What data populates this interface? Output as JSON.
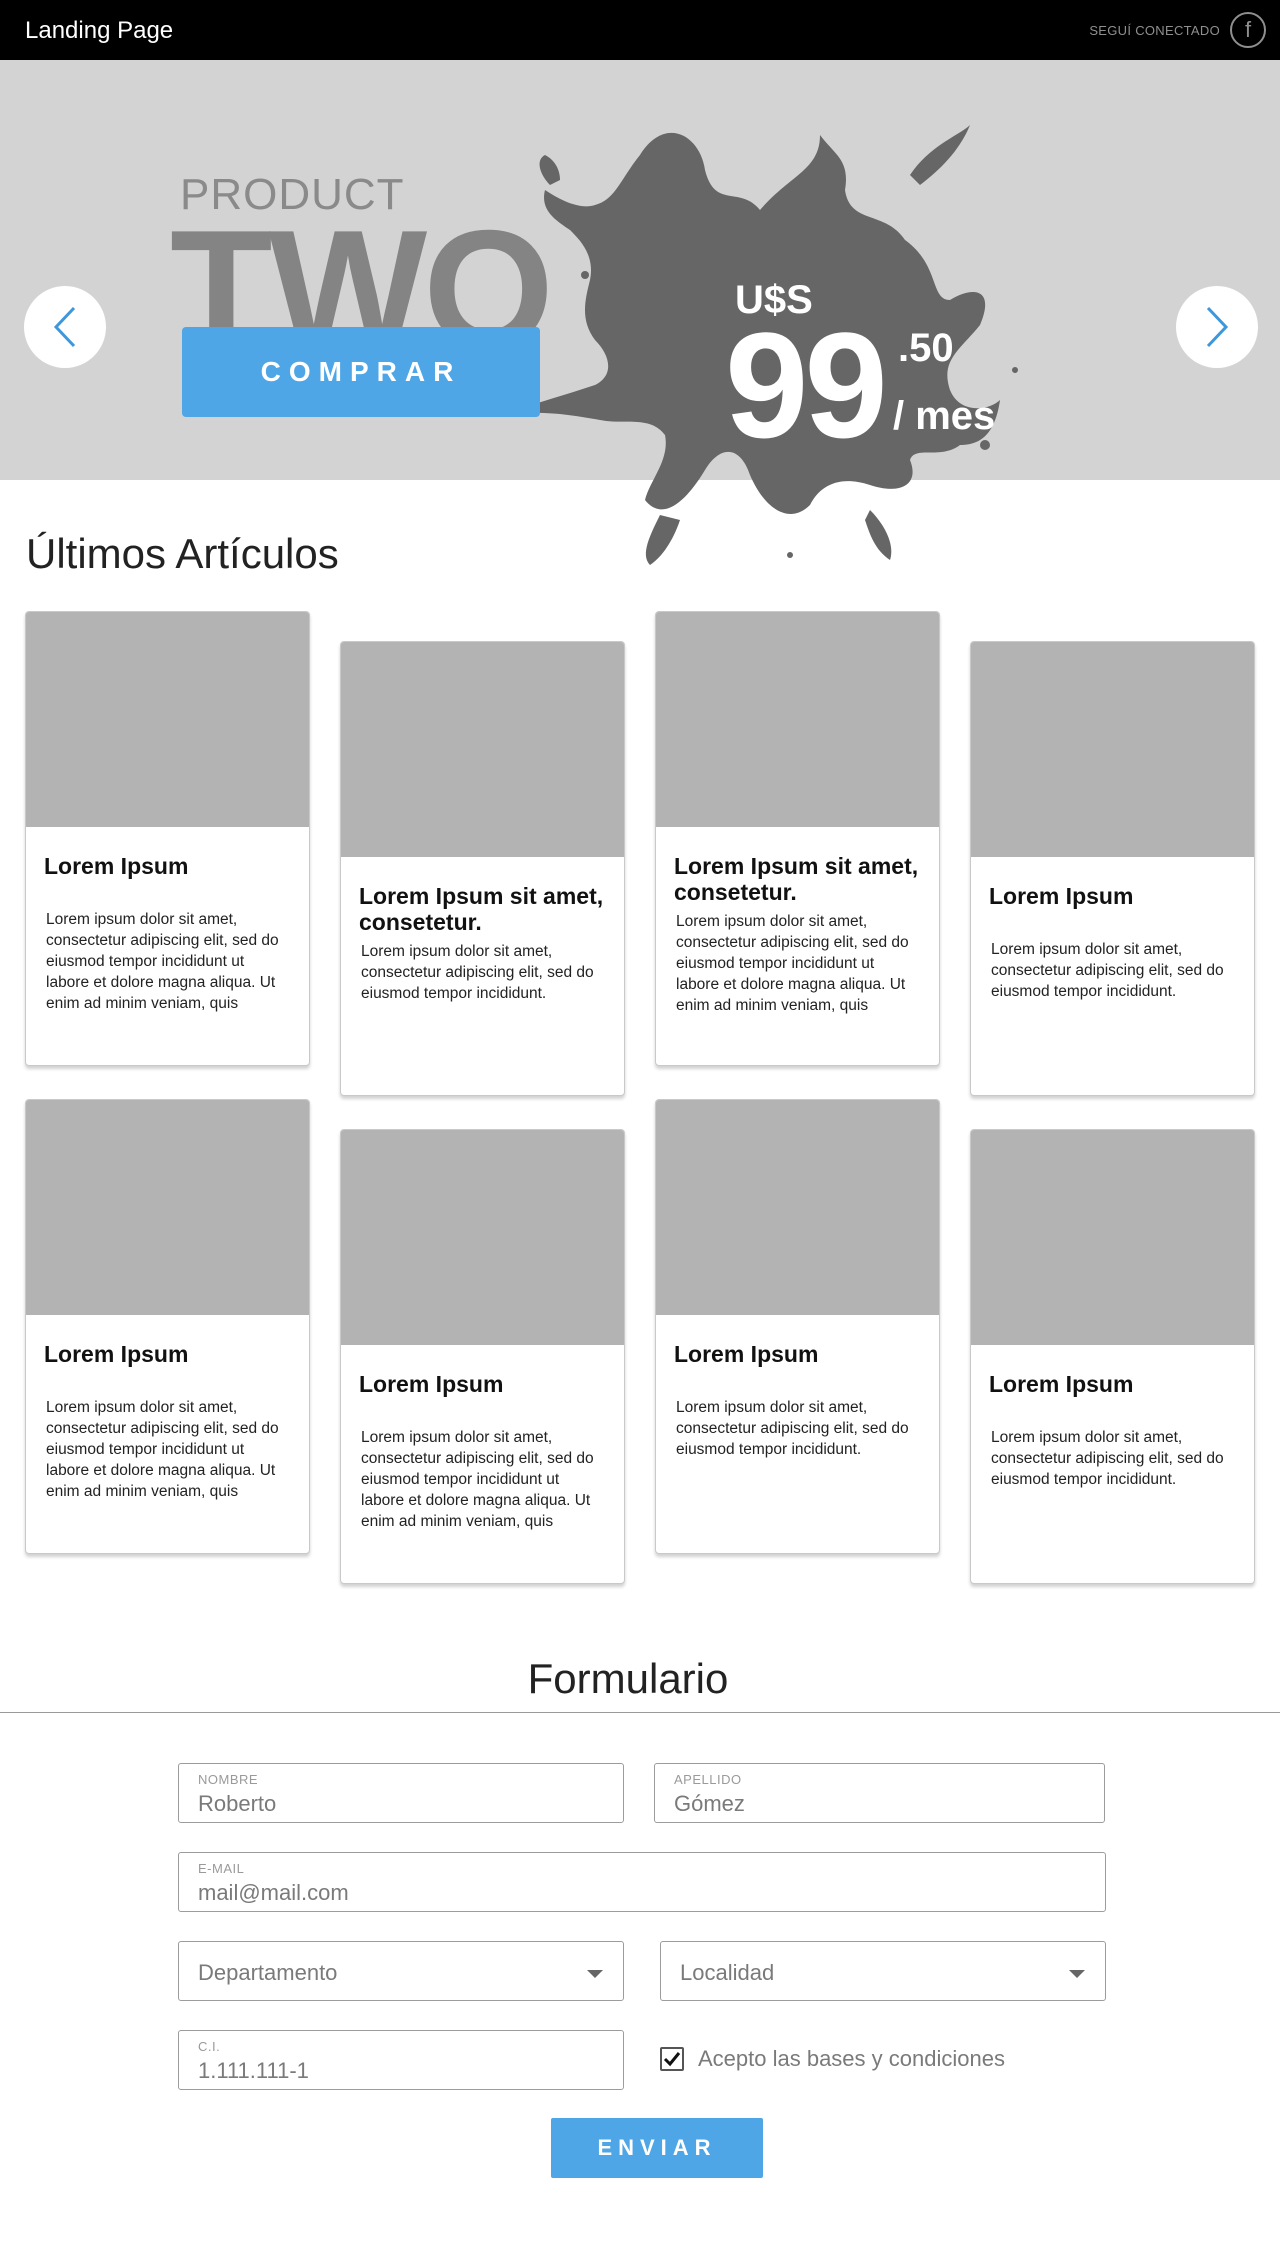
{
  "header": {
    "brand": "Landing Page",
    "social_label": "SEGUÍ CONECTADO",
    "social_icon": "facebook-icon",
    "social_glyph": "f"
  },
  "hero": {
    "kicker": "PRODUCT",
    "headline": "TWO",
    "buy_label": "COMPRAR",
    "price": {
      "currency": "U$S",
      "integer": "99",
      "decimal": ".50",
      "period": "/ mes"
    },
    "colors": {
      "background": "#d3d3d3",
      "splash": "#666666",
      "button": "#4ea6e6",
      "arrow": "#3d97dd"
    }
  },
  "articles": {
    "title": "Últimos Artículos",
    "cards": [
      {
        "title": "Lorem Ipsum",
        "body": "Lorem ipsum dolor sit amet, consectetur adipiscing elit, sed do eiusmod tempor incididunt ut labore et dolore magna aliqua. Ut enim ad minim veniam, quis"
      },
      {
        "title": "Lorem Ipsum sit amet, consetetur.",
        "body": "Lorem ipsum dolor sit amet, consectetur adipiscing elit, sed do eiusmod tempor incididunt."
      },
      {
        "title": "Lorem Ipsum sit amet, consetetur.",
        "body": "Lorem ipsum dolor sit amet, consectetur adipiscing elit, sed do eiusmod tempor incididunt ut labore et dolore magna aliqua. Ut enim ad minim veniam, quis"
      },
      {
        "title": "Lorem Ipsum",
        "body": "Lorem ipsum dolor sit amet, consectetur adipiscing elit, sed do eiusmod tempor incididunt."
      },
      {
        "title": "Lorem Ipsum",
        "body": "Lorem ipsum dolor sit amet, consectetur adipiscing elit, sed do eiusmod tempor incididunt ut labore et dolore magna aliqua. Ut enim ad minim veniam, quis"
      },
      {
        "title": "Lorem Ipsum",
        "body": "Lorem ipsum dolor sit amet, consectetur adipiscing elit, sed do eiusmod tempor incididunt ut labore et dolore magna aliqua. Ut enim ad minim veniam, quis"
      },
      {
        "title": "Lorem Ipsum",
        "body": "Lorem ipsum dolor sit amet, consectetur adipiscing elit, sed do eiusmod tempor incididunt."
      },
      {
        "title": "Lorem Ipsum",
        "body": "Lorem ipsum dolor sit amet, consectetur adipiscing elit, sed do eiusmod tempor incididunt."
      }
    ]
  },
  "form": {
    "title": "Formulario",
    "nombre": {
      "label": "NOMBRE",
      "value": "Roberto"
    },
    "apellido": {
      "label": "APELLIDO",
      "value": "Gómez"
    },
    "email": {
      "label": "E-MAIL",
      "value": "mail@mail.com"
    },
    "departamento": {
      "value": "Departamento"
    },
    "localidad": {
      "value": "Localidad"
    },
    "ci": {
      "label": "C.I.",
      "value": "1.111.111-1"
    },
    "terms": {
      "label": "Acepto las bases y condiciones",
      "checked": true
    },
    "submit_label": "ENVIAR"
  }
}
